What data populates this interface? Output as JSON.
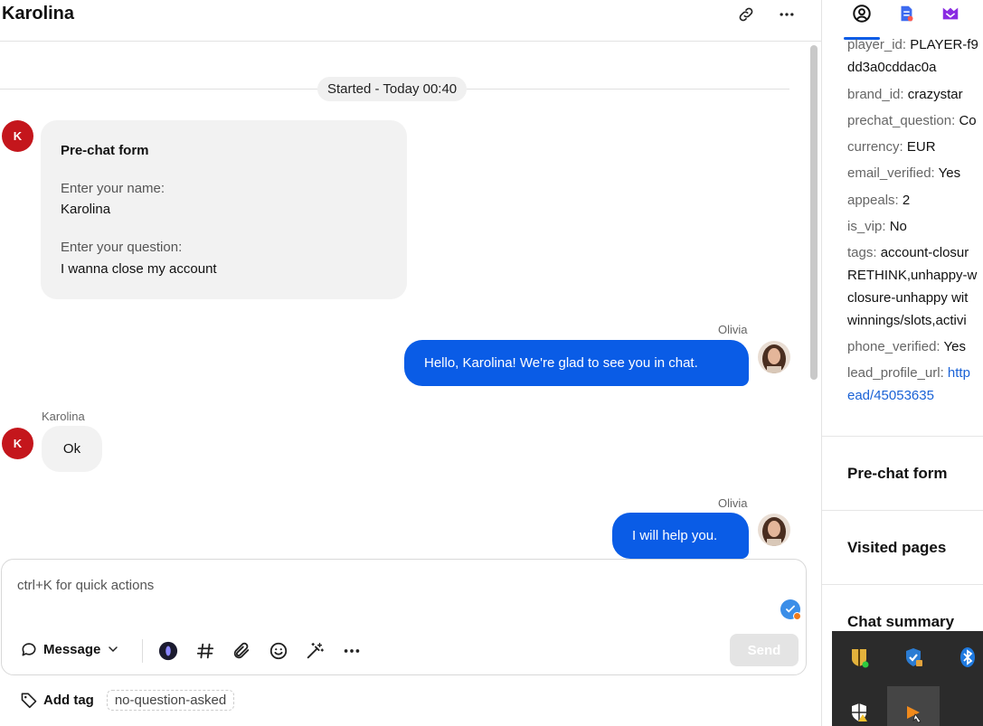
{
  "header": {
    "title": "Karolina",
    "link_icon": "link-icon",
    "more_icon": "more-horizontal-icon"
  },
  "conversation": {
    "started_label": "Started - Today 00:40",
    "customer_initial": "K",
    "prechat": {
      "title": "Pre-chat form",
      "name_label": "Enter your name:",
      "name_value": "Karolina",
      "question_label": "Enter your question:",
      "question_value": "I wanna close my account"
    },
    "messages": [
      {
        "sender": "Olivia",
        "text": "Hello, Karolina! We're glad to see you in chat.",
        "direction": "out"
      },
      {
        "sender": "Karolina",
        "text": "Ok",
        "direction": "in"
      },
      {
        "sender": "Olivia",
        "text": "I will help you.",
        "direction": "out"
      }
    ]
  },
  "composer": {
    "placeholder": "ctrl+K for quick actions",
    "mode_label": "Message",
    "send_label": "Send",
    "tools": [
      "ai-assistant-icon",
      "hashtag-icon",
      "paperclip-icon",
      "emoji-icon",
      "magic-wand-icon",
      "more-horizontal-icon"
    ]
  },
  "tags": {
    "add_label": "Add tag",
    "items": [
      "no-question-asked"
    ]
  },
  "right_panel": {
    "tabs": [
      "user-circle-icon",
      "document-icon",
      "mail-icon"
    ],
    "attributes": {
      "player_id_key": "player_id:",
      "player_id_value": "PLAYER-f9",
      "player_id_cont": "dd3a0cddac0a",
      "brand_id_key": "brand_id:",
      "brand_id_value": "crazystar",
      "prechat_question_key": "prechat_question:",
      "prechat_question_value": "Co",
      "currency_key": "currency:",
      "currency_value": "EUR",
      "email_verified_key": "email_verified:",
      "email_verified_value": "Yes",
      "appeals_key": "appeals:",
      "appeals_value": "2",
      "is_vip_key": "is_vip:",
      "is_vip_value": "No",
      "tags_key": "tags:",
      "tags_value_1": "account-closur",
      "tags_value_2": "RETHINK,unhappy-w",
      "tags_value_3": "closure-unhappy wit",
      "tags_value_4": "winnings/slots,activi",
      "phone_verified_key": "phone_verified:",
      "phone_verified_value": "Yes",
      "lead_profile_url_key": "lead_profile_url:",
      "lead_profile_url_value": "http",
      "lead_profile_url_cont": "ead/45053635"
    },
    "sections": {
      "prechat": "Pre-chat form",
      "visited": "Visited pages",
      "summary": "Chat summary"
    }
  },
  "colors": {
    "accent": "#0a5ce6",
    "customer_avatar": "#c4161c",
    "bubble_in": "#f2f2f2"
  }
}
